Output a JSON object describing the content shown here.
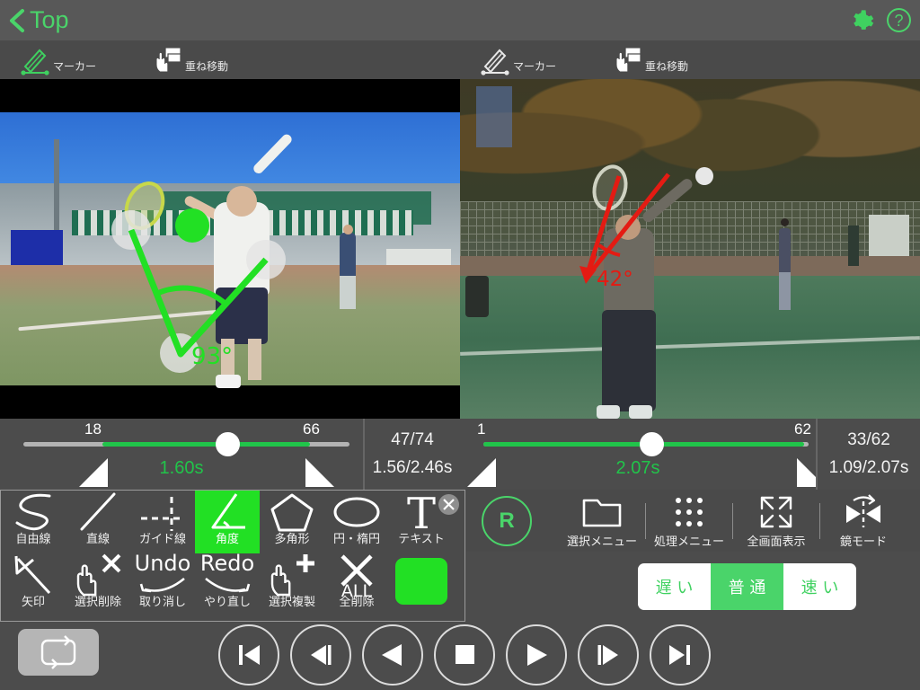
{
  "navbar": {
    "back_label": "Top",
    "back_icon": "chevron-left-icon",
    "gear_icon": "gear-icon",
    "help_label": "?",
    "accent_green": "#4ad46a"
  },
  "toolbars": {
    "left": {
      "marker": {
        "label": "マーカー",
        "icon": "marker-pen-icon"
      },
      "overlay_move": {
        "label": "重ね移動",
        "icon": "hand-drag-layers-icon"
      }
    },
    "right": {
      "marker": {
        "label": "マーカー",
        "icon": "marker-pen-icon"
      },
      "overlay_move": {
        "label": "重ね移動",
        "icon": "hand-drag-layers-icon"
      }
    }
  },
  "videos": {
    "left": {
      "annotation_color": "#22e024",
      "angle_label": "93°",
      "letterbox": true
    },
    "right": {
      "annotation_color": "#e41b13",
      "angle_label": "42°",
      "letterbox": false
    }
  },
  "seek_left": {
    "mark_in": "18",
    "mark_out": "66",
    "current_time": "1.60s",
    "frames": "47/74",
    "time_readout": "1.56/2.46s",
    "fill_color": "#21c44a"
  },
  "seek_right": {
    "mark_in": "1",
    "mark_out": "62",
    "current_time": "2.07s",
    "frames": "33/62",
    "time_readout": "1.09/2.07s",
    "fill_color": "#21c44a"
  },
  "palette": {
    "close_icon": "close-icon",
    "selected_color": "#22e024",
    "row1": [
      {
        "label": "自由線",
        "icon": "freehand-line-icon",
        "selected": false
      },
      {
        "label": "直線",
        "icon": "straight-line-icon",
        "selected": false
      },
      {
        "label": "ガイド線",
        "icon": "guide-line-icon",
        "selected": false
      },
      {
        "label": "角度",
        "icon": "angle-icon",
        "selected": true
      },
      {
        "label": "多角形",
        "icon": "polygon-icon",
        "selected": false
      },
      {
        "label": "円・楕円",
        "icon": "ellipse-icon",
        "selected": false
      },
      {
        "label": "テキスト",
        "icon": "text-icon",
        "selected": false
      }
    ],
    "row2": [
      {
        "label": "矢印",
        "icon": "arrow-icon",
        "selected": false
      },
      {
        "label": "選択削除",
        "icon": "delete-selection-icon",
        "selected": false
      },
      {
        "label": "取り消し",
        "icon": "undo-icon",
        "top_label": "Undo",
        "selected": false
      },
      {
        "label": "やり直し",
        "icon": "redo-icon",
        "top_label": "Redo",
        "selected": false
      },
      {
        "label": "選択複製",
        "icon": "duplicate-selection-icon",
        "selected": false
      },
      {
        "label": "全削除",
        "icon": "delete-all-icon",
        "top_label": "ALL",
        "selected": false
      },
      {
        "label": "",
        "icon": "color-swatch",
        "swatch_color": "#22e024",
        "selected": false
      }
    ]
  },
  "funcbar": {
    "side_badge": "R",
    "items": [
      {
        "label": "選択メニュー",
        "icon": "folder-icon"
      },
      {
        "label": "処理メニュー",
        "icon": "grid-dots-icon"
      },
      {
        "label": "全画面表示",
        "icon": "fullscreen-icon"
      },
      {
        "label": "鏡モード",
        "icon": "mirror-mode-icon"
      }
    ]
  },
  "speed": {
    "options": [
      {
        "label": "遅 い",
        "active": false
      },
      {
        "label": "普 通",
        "active": true
      },
      {
        "label": "速 い",
        "active": false
      }
    ]
  },
  "playback": {
    "loop_icon": "loop-icon",
    "buttons": [
      {
        "name": "skip-to-start-button",
        "icon": "skip-start-icon"
      },
      {
        "name": "step-back-button",
        "icon": "step-back-icon"
      },
      {
        "name": "rewind-button",
        "icon": "rewind-icon"
      },
      {
        "name": "stop-button",
        "icon": "stop-icon"
      },
      {
        "name": "play-button",
        "icon": "play-icon"
      },
      {
        "name": "step-forward-button",
        "icon": "step-forward-icon"
      },
      {
        "name": "skip-to-end-button",
        "icon": "skip-end-icon"
      }
    ]
  }
}
